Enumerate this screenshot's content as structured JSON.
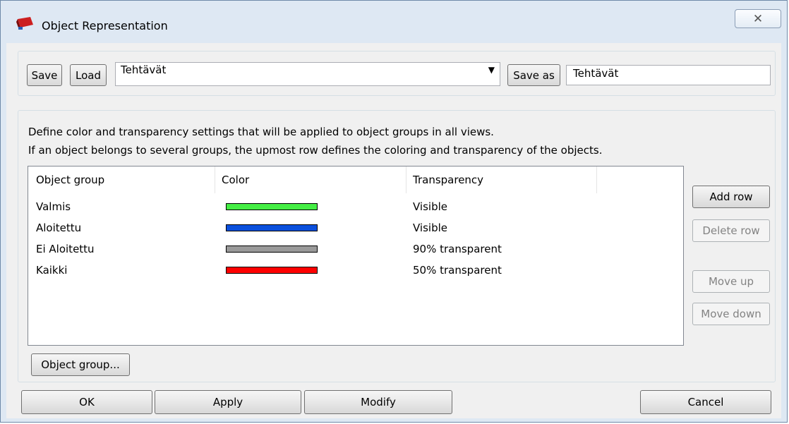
{
  "window": {
    "title": "Object Representation",
    "close_glyph": "✕"
  },
  "top": {
    "save_label": "Save",
    "load_label": "Load",
    "settings_value": "Tehtävät",
    "save_as_label": "Save as",
    "save_as_value": "Tehtävät"
  },
  "description": {
    "line1": "Define color and transparency settings that will be applied to object groups in all views.",
    "line2": "If an object belongs to several groups, the upmost row defines the coloring and transparency of the objects."
  },
  "table": {
    "columns": [
      "Object group",
      "Color",
      "Transparency"
    ],
    "rows": [
      {
        "group": "Valmis",
        "color": "#44ee44",
        "transparency": "Visible"
      },
      {
        "group": "Aloitettu",
        "color": "#0b50dd",
        "transparency": "Visible"
      },
      {
        "group": "Ei Aloitettu",
        "color": "#9a9a9a",
        "transparency": "90% transparent"
      },
      {
        "group": "Kaikki",
        "color": "#ff0000",
        "transparency": "50% transparent"
      }
    ]
  },
  "side": {
    "add_row": "Add row",
    "delete_row": "Delete row",
    "move_up": "Move up",
    "move_down": "Move down"
  },
  "object_group_button": "Object group...",
  "bottom": {
    "ok": "OK",
    "apply": "Apply",
    "modify": "Modify",
    "cancel": "Cancel"
  }
}
